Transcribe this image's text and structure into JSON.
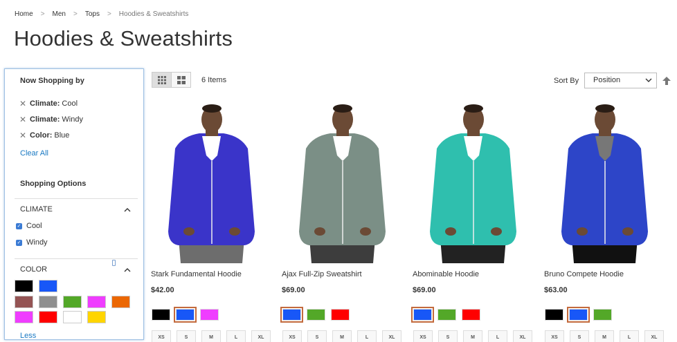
{
  "breadcrumb": {
    "items": [
      "Home",
      "Men",
      "Tops"
    ],
    "current": "Hoodies & Sweatshirts",
    "separator": ">"
  },
  "page_title": "Hoodies & Sweatshirts",
  "sidebar": {
    "now_shopping_title": "Now Shopping by",
    "active_filters": [
      {
        "label": "Climate:",
        "value": "Cool"
      },
      {
        "label": "Climate:",
        "value": "Windy"
      },
      {
        "label": "Color:",
        "value": "Blue"
      }
    ],
    "clear_all": "Clear All",
    "shopping_options_title": "Shopping Options",
    "climate": {
      "title": "CLIMATE",
      "options": [
        "Cool",
        "Windy"
      ]
    },
    "color": {
      "title": "COLOR",
      "swatches": [
        "#000000",
        "#1857f7",
        "#945454",
        "#8f8f8f",
        "#53a828",
        "#ef3dff",
        "#eb6703",
        "#ef3dff",
        "#ff0000",
        "#ffffff",
        "#ffd500"
      ]
    },
    "less": "Less"
  },
  "toolbar": {
    "items_count": "6 Items",
    "sort_label": "Sort By",
    "sort_value": "Position"
  },
  "products": [
    {
      "name": "Stark Fundamental Hoodie",
      "price": "$42.00",
      "colors": [
        "#000000",
        "#1857f7",
        "#ef3dff"
      ],
      "selected": 1,
      "hoodie": "#3a34c9",
      "shirt": "#ffffff",
      "pants": "#6d6d6d"
    },
    {
      "name": "Ajax Full-Zip Sweatshirt",
      "price": "$69.00",
      "colors": [
        "#1857f7",
        "#53a828",
        "#ff0000"
      ],
      "selected": 0,
      "hoodie": "#7b8f86",
      "shirt": "#ffffff",
      "pants": "#3d3d3d"
    },
    {
      "name": "Abominable Hoodie",
      "price": "$69.00",
      "colors": [
        "#1857f7",
        "#53a828",
        "#ff0000"
      ],
      "selected": 0,
      "hoodie": "#2fbfae",
      "shirt": "#ffffff",
      "pants": "#222222"
    },
    {
      "name": "Bruno Compete Hoodie",
      "price": "$63.00",
      "colors": [
        "#000000",
        "#1857f7",
        "#53a828"
      ],
      "selected": 1,
      "hoodie": "#2d45c8",
      "shirt": "#777777",
      "pants": "#111111"
    }
  ],
  "sizes": [
    "XS",
    "S",
    "M",
    "L",
    "XL"
  ]
}
